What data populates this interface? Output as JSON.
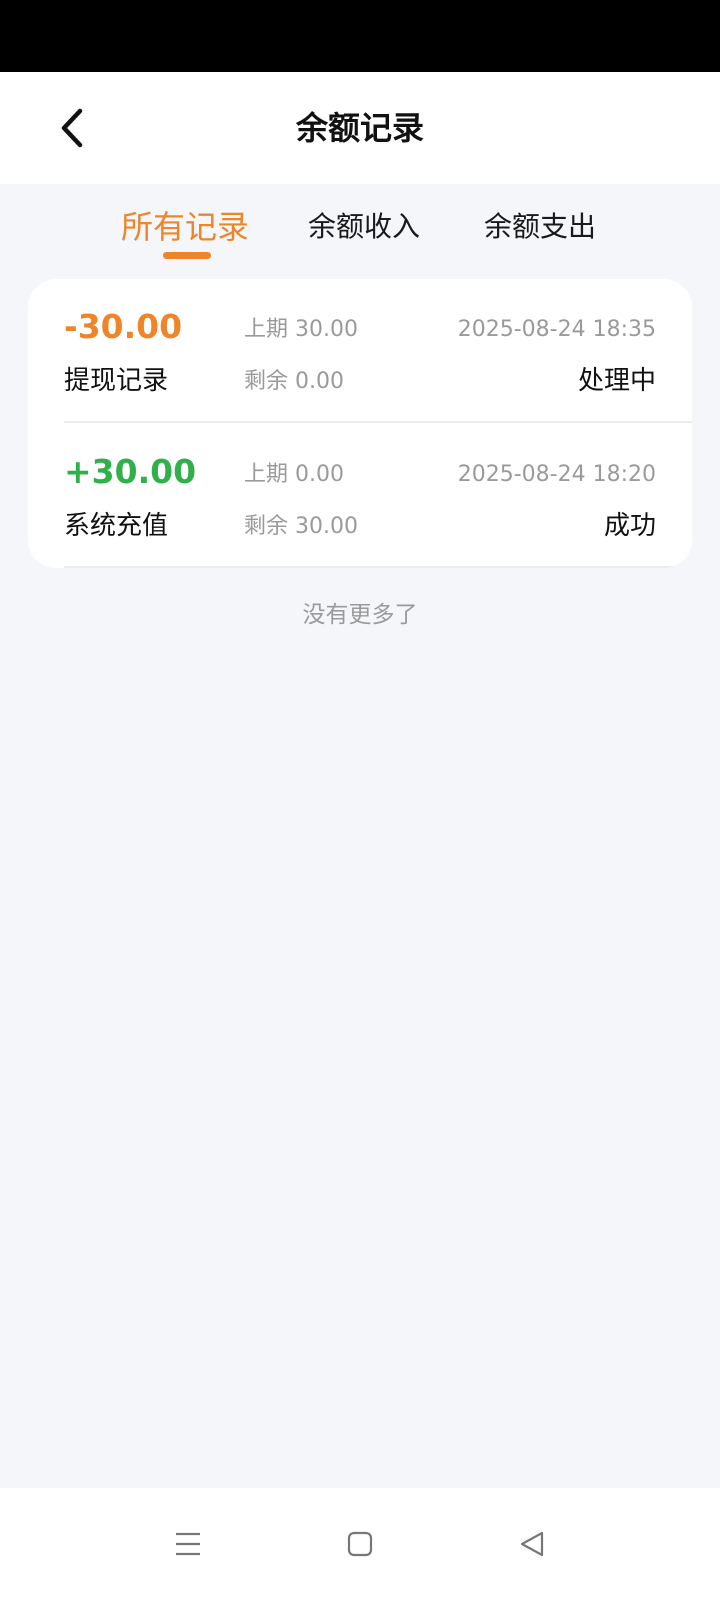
{
  "header": {
    "title": "余额记录"
  },
  "tabs": [
    {
      "label": "所有记录",
      "active": true
    },
    {
      "label": "余额收入",
      "active": false
    },
    {
      "label": "余额支出",
      "active": false
    }
  ],
  "records": [
    {
      "amount": "-30.00",
      "type": "提现记录",
      "prev_balance": "上期 30.00",
      "remaining": "剩余 0.00",
      "time": "2025-08-24 18:35",
      "status": "处理中"
    },
    {
      "amount": "+30.00",
      "type": "系统充值",
      "prev_balance": "上期 0.00",
      "remaining": "剩余 30.00",
      "time": "2025-08-24 18:20",
      "status": "成功"
    }
  ],
  "list_footer": "没有更多了",
  "colors": {
    "accent": "#ee8528",
    "income": "#30b04a",
    "background": "#f5f6fa"
  },
  "icons": {
    "back": "chevron-left-icon",
    "nav_menu": "menu-icon",
    "nav_home": "home-square-icon",
    "nav_back": "triangle-back-icon"
  }
}
